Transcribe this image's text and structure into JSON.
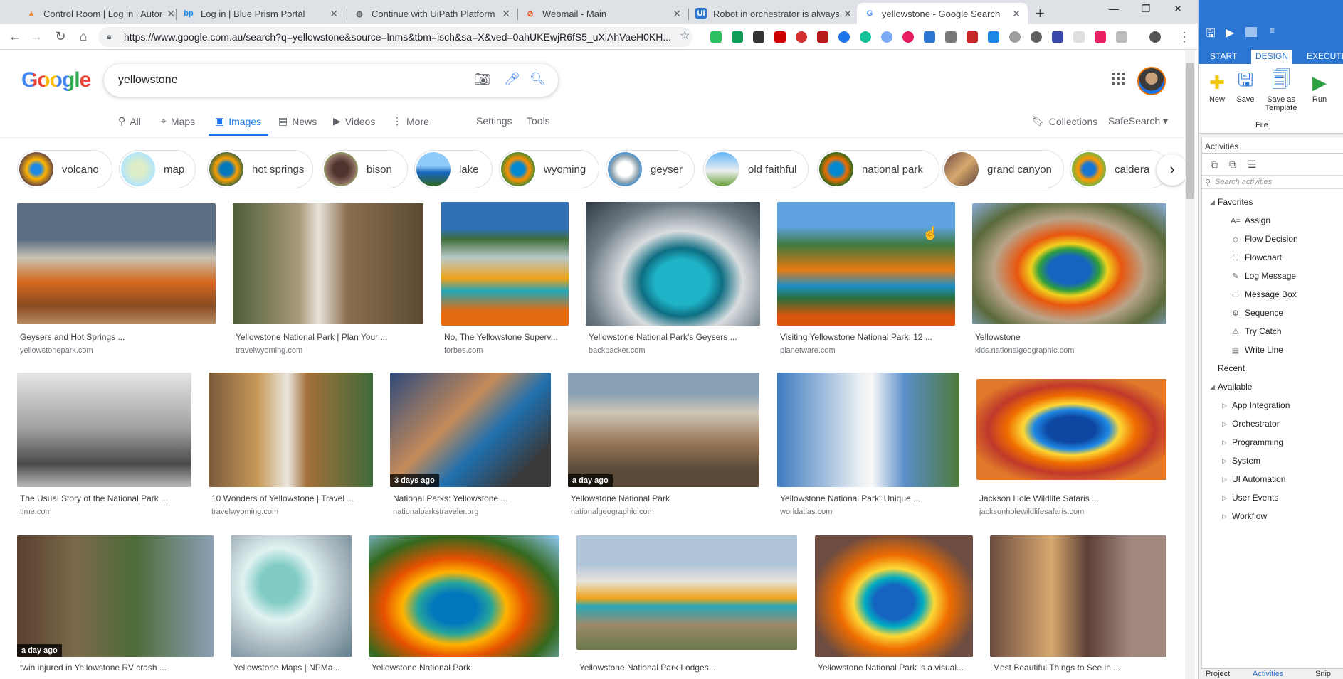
{
  "browser": {
    "tabs": [
      {
        "title": "Control Room | Log in | Automat",
        "icon": "automation-anywhere-icon",
        "color": "#f28b30"
      },
      {
        "title": "Log in | Blue Prism Portal",
        "icon": "blue-prism-icon",
        "color": "#1e88e5"
      },
      {
        "title": "Continue with UiPath Platform",
        "icon": "globe-icon",
        "color": "#5f6368"
      },
      {
        "title": "Webmail - Main",
        "icon": "webmail-icon",
        "color": "#e8551f"
      },
      {
        "title": "Robot in orchestrator is always d",
        "icon": "uipath-icon",
        "color": "#2b76d2"
      },
      {
        "title": "yellowstone - Google Search",
        "icon": "google-icon",
        "color": "#4285f4"
      }
    ],
    "new_tab": "+",
    "window_controls": {
      "minimize": "—",
      "maximize": "❐",
      "close": "✕"
    },
    "url": "https://www.google.com.au/search?q=yellowstone&source=lnms&tbm=isch&sa=X&ved=0ahUKEwjR6fS5_uXiAhVaeH0KH..."
  },
  "google": {
    "logo": "Google",
    "query": "yellowstone",
    "nav_tabs": [
      {
        "label": "All",
        "icon": "search-icon"
      },
      {
        "label": "Maps",
        "icon": "map-pin-icon"
      },
      {
        "label": "Images",
        "icon": "image-icon"
      },
      {
        "label": "News",
        "icon": "news-icon"
      },
      {
        "label": "Videos",
        "icon": "video-icon"
      },
      {
        "label": "More",
        "icon": "more-vert-icon"
      }
    ],
    "settings": "Settings",
    "tools": "Tools",
    "collections": "Collections",
    "safesearch": "SafeSearch ▾",
    "chips": [
      "volcano",
      "map",
      "hot springs",
      "bison",
      "lake",
      "wyoming",
      "geyser",
      "old faithful",
      "national park",
      "grand canyon",
      "caldera"
    ],
    "results": [
      {
        "caption": "Geysers and Hot Springs ...",
        "source": "yellowstonepark.com",
        "badge": ""
      },
      {
        "caption": "Yellowstone National Park | Plan Your ...",
        "source": "travelwyoming.com",
        "badge": ""
      },
      {
        "caption": "No, The Yellowstone Superv...",
        "source": "forbes.com",
        "badge": ""
      },
      {
        "caption": "Yellowstone National Park's Geysers ...",
        "source": "backpacker.com",
        "badge": ""
      },
      {
        "caption": "Visiting Yellowstone National Park: 12 ...",
        "source": "planetware.com",
        "badge": ""
      },
      {
        "caption": "Yellowstone",
        "source": "kids.nationalgeographic.com",
        "badge": ""
      },
      {
        "caption": "The Usual Story of the National Park ...",
        "source": "time.com",
        "badge": ""
      },
      {
        "caption": "10 Wonders of Yellowstone | Travel ...",
        "source": "travelwyoming.com",
        "badge": ""
      },
      {
        "caption": "National Parks: Yellowstone ...",
        "source": "nationalparkstraveler.org",
        "badge": "3 days ago"
      },
      {
        "caption": "Yellowstone National Park",
        "source": "nationalgeographic.com",
        "badge": "a day ago"
      },
      {
        "caption": "Yellowstone National Park: Unique ...",
        "source": "worldatlas.com",
        "badge": ""
      },
      {
        "caption": "Jackson Hole Wildlife Safaris ...",
        "source": "jacksonholewildlifesafaris.com",
        "badge": ""
      },
      {
        "caption": "twin injured in Yellowstone RV crash ...",
        "source": "",
        "badge": "a day ago"
      },
      {
        "caption": "Yellowstone Maps | NPMa...",
        "source": "",
        "badge": ""
      },
      {
        "caption": "Yellowstone National Park",
        "source": "",
        "badge": ""
      },
      {
        "caption": "Yellowstone National Park Lodges ...",
        "source": "",
        "badge": ""
      },
      {
        "caption": "Yellowstone National Park is a visual...",
        "source": "",
        "badge": ""
      },
      {
        "caption": "Most Beautiful Things to See in ...",
        "source": "",
        "badge": ""
      }
    ]
  },
  "uipath": {
    "tabs": [
      "START",
      "DESIGN",
      "EXECUTE"
    ],
    "ribbon": [
      {
        "label": "New",
        "icon": "new-file-icon"
      },
      {
        "label": "Save",
        "icon": "save-icon"
      },
      {
        "label": "Save as Template",
        "icon": "save-template-icon"
      },
      {
        "label": "Run",
        "icon": "run-icon"
      }
    ],
    "ribbon_group": "File",
    "panel_title": "Activities",
    "search_placeholder": "Search activities",
    "favorites_label": "Favorites",
    "favorites": [
      "Assign",
      "Flow Decision",
      "Flowchart",
      "Log Message",
      "Message Box",
      "Sequence",
      "Try Catch",
      "Write Line"
    ],
    "recent_label": "Recent",
    "available_label": "Available",
    "available": [
      "App Integration",
      "Orchestrator",
      "Programming",
      "System",
      "UI Automation",
      "User Events",
      "Workflow"
    ],
    "bottom_tabs": [
      "Project",
      "Activities",
      "Snip"
    ]
  }
}
